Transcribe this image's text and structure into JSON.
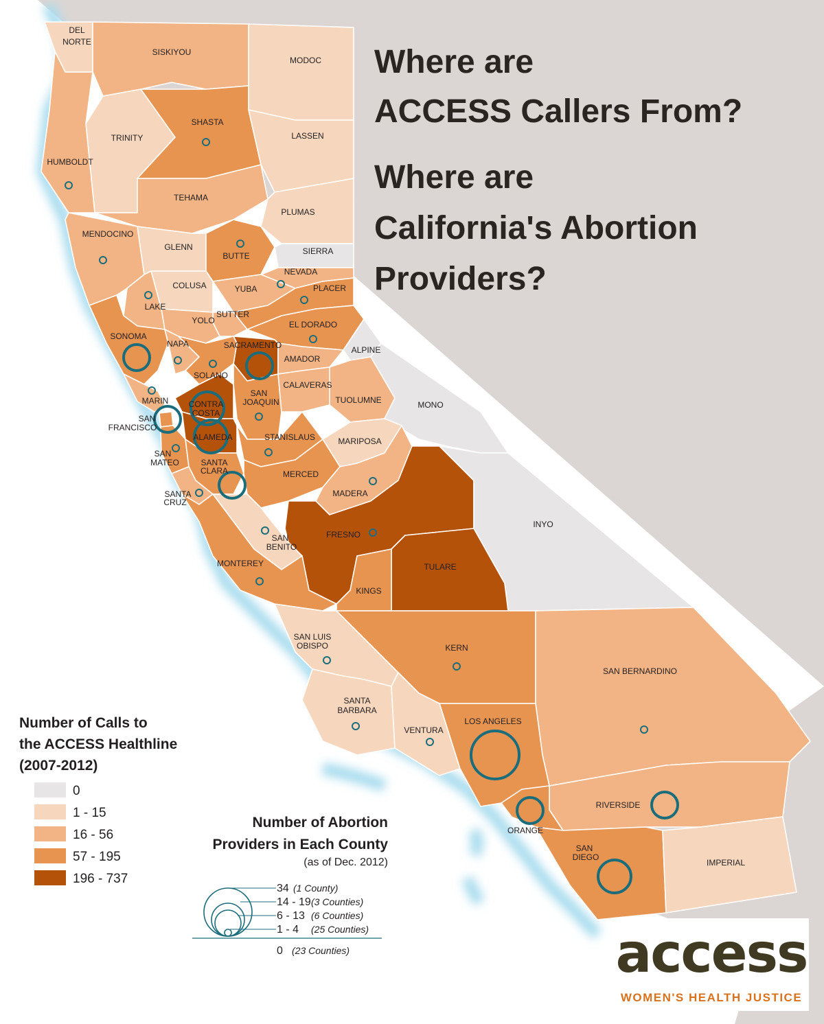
{
  "title": {
    "line1": "Where are",
    "line2": "ACCESS Callers From?",
    "line3": "Where are",
    "line4": "California's Abortion",
    "line5": "Providers?"
  },
  "colors": {
    "bin0": "#e7e5e5",
    "bin1": "#f6d7bd",
    "bin2": "#f2b484",
    "bin3": "#e79451",
    "bin4": "#b55209",
    "provider_ring": "#1b6d7b",
    "ocean_glow": "#a8dcee",
    "neighbor": "#dbd6d4"
  },
  "calls_legend": {
    "title_line1": "Number of Calls to",
    "title_line2": "the ACCESS Healthline",
    "title_line3": "(2007-2012)",
    "bins": [
      {
        "label": "0",
        "color": "#e7e5e5"
      },
      {
        "label": "1 - 15",
        "color": "#f6d7bd"
      },
      {
        "label": "16 - 56",
        "color": "#f2b484"
      },
      {
        "label": "57 - 195",
        "color": "#e79451"
      },
      {
        "label": "196 - 737",
        "color": "#b55209"
      }
    ]
  },
  "providers_legend": {
    "title_line1": "Number of Abortion",
    "title_line2": "Providers in Each County",
    "title_line3": "(as of Dec. 2012)",
    "sizes": [
      {
        "range": "34",
        "counties": "(1 County)",
        "tier": 4
      },
      {
        "range": "14 - 19",
        "counties": "(3 Counties)",
        "tier": 3
      },
      {
        "range": "6 - 13",
        "counties": "(6 Counties)",
        "tier": 2
      },
      {
        "range": "1 - 4",
        "counties": "(25 Counties)",
        "tier": 1
      },
      {
        "range": "0",
        "counties": "(23 Counties)",
        "tier": 0
      }
    ]
  },
  "counties": [
    {
      "name": "DEL NORTE",
      "bin": 1,
      "provider_tier": 0
    },
    {
      "name": "SISKIYOU",
      "bin": 2,
      "provider_tier": 0
    },
    {
      "name": "MODOC",
      "bin": 1,
      "provider_tier": 0
    },
    {
      "name": "TRINITY",
      "bin": 1,
      "provider_tier": 0
    },
    {
      "name": "SHASTA",
      "bin": 3,
      "provider_tier": 1
    },
    {
      "name": "LASSEN",
      "bin": 1,
      "provider_tier": 0
    },
    {
      "name": "HUMBOLDT",
      "bin": 2,
      "provider_tier": 1
    },
    {
      "name": "TEHAMA",
      "bin": 2,
      "provider_tier": 0
    },
    {
      "name": "PLUMAS",
      "bin": 1,
      "provider_tier": 0
    },
    {
      "name": "MENDOCINO",
      "bin": 2,
      "provider_tier": 1
    },
    {
      "name": "GLENN",
      "bin": 1,
      "provider_tier": 0
    },
    {
      "name": "BUTTE",
      "bin": 3,
      "provider_tier": 1
    },
    {
      "name": "SIERRA",
      "bin": 0,
      "provider_tier": 0
    },
    {
      "name": "NEVADA",
      "bin": 2,
      "provider_tier": 1
    },
    {
      "name": "COLUSA",
      "bin": 1,
      "provider_tier": 0
    },
    {
      "name": "YUBA",
      "bin": 2,
      "provider_tier": 0
    },
    {
      "name": "PLACER",
      "bin": 3,
      "provider_tier": 1
    },
    {
      "name": "LAKE",
      "bin": 2,
      "provider_tier": 1
    },
    {
      "name": "SUTTER",
      "bin": 2,
      "provider_tier": 0
    },
    {
      "name": "YOLO",
      "bin": 2,
      "provider_tier": 0
    },
    {
      "name": "EL DORADO",
      "bin": 3,
      "provider_tier": 1
    },
    {
      "name": "SONOMA",
      "bin": 3,
      "provider_tier": 2
    },
    {
      "name": "NAPA",
      "bin": 2,
      "provider_tier": 1
    },
    {
      "name": "SACRAMENTO",
      "bin": 4,
      "provider_tier": 2
    },
    {
      "name": "AMADOR",
      "bin": 2,
      "provider_tier": 0
    },
    {
      "name": "ALPINE",
      "bin": 0,
      "provider_tier": 0
    },
    {
      "name": "SOLANO",
      "bin": 3,
      "provider_tier": 1
    },
    {
      "name": "MARIN",
      "bin": 2,
      "provider_tier": 1
    },
    {
      "name": "CONTRA COSTA",
      "bin": 4,
      "provider_tier": 3
    },
    {
      "name": "SAN JOAQUIN",
      "bin": 3,
      "provider_tier": 1
    },
    {
      "name": "CALAVERAS",
      "bin": 2,
      "provider_tier": 0
    },
    {
      "name": "TUOLUMNE",
      "bin": 2,
      "provider_tier": 0
    },
    {
      "name": "MONO",
      "bin": 0,
      "provider_tier": 0
    },
    {
      "name": "SAN FRANCISCO",
      "bin": 3,
      "provider_tier": 2
    },
    {
      "name": "ALAMEDA",
      "bin": 4,
      "provider_tier": 3
    },
    {
      "name": "STANISLAUS",
      "bin": 3,
      "provider_tier": 1
    },
    {
      "name": "MARIPOSA",
      "bin": 1,
      "provider_tier": 0
    },
    {
      "name": "SAN MATEO",
      "bin": 3,
      "provider_tier": 1
    },
    {
      "name": "SANTA CLARA",
      "bin": 3,
      "provider_tier": 2
    },
    {
      "name": "MERCED",
      "bin": 3,
      "provider_tier": 0
    },
    {
      "name": "MADERA",
      "bin": 2,
      "provider_tier": 1
    },
    {
      "name": "SANTA CRUZ",
      "bin": 2,
      "provider_tier": 1
    },
    {
      "name": "SAN BENITO",
      "bin": 1,
      "provider_tier": 1
    },
    {
      "name": "FRESNO",
      "bin": 4,
      "provider_tier": 1
    },
    {
      "name": "INYO",
      "bin": 0,
      "provider_tier": 0
    },
    {
      "name": "MONTEREY",
      "bin": 3,
      "provider_tier": 1
    },
    {
      "name": "TULARE",
      "bin": 4,
      "provider_tier": 0
    },
    {
      "name": "KINGS",
      "bin": 3,
      "provider_tier": 0
    },
    {
      "name": "SAN LUIS OBISPO",
      "bin": 1,
      "provider_tier": 1
    },
    {
      "name": "KERN",
      "bin": 3,
      "provider_tier": 1
    },
    {
      "name": "SAN BERNARDINO",
      "bin": 2,
      "provider_tier": 1
    },
    {
      "name": "SANTA BARBARA",
      "bin": 1,
      "provider_tier": 1
    },
    {
      "name": "VENTURA",
      "bin": 1,
      "provider_tier": 1
    },
    {
      "name": "LOS ANGELES",
      "bin": 3,
      "provider_tier": 4
    },
    {
      "name": "RIVERSIDE",
      "bin": 2,
      "provider_tier": 2
    },
    {
      "name": "ORANGE",
      "bin": 3,
      "provider_tier": 2
    },
    {
      "name": "SAN DIEGO",
      "bin": 3,
      "provider_tier": 3
    },
    {
      "name": "IMPERIAL",
      "bin": 1,
      "provider_tier": 0
    }
  ],
  "logo": {
    "wordmark": "access",
    "tagline": "WOMEN'S HEALTH JUSTICE"
  }
}
